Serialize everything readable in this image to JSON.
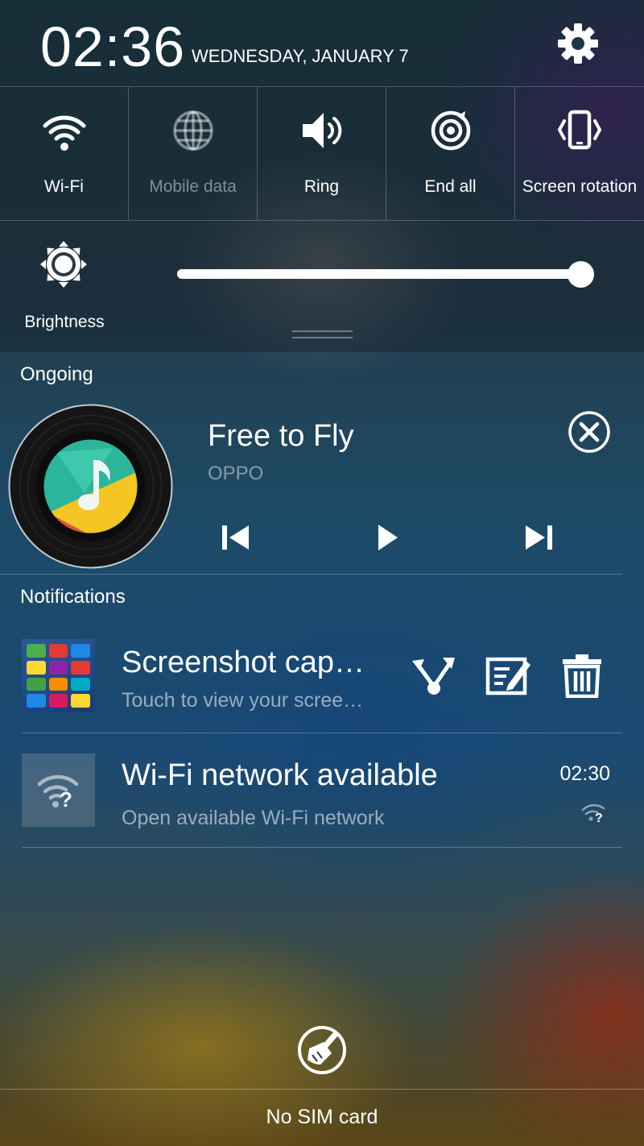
{
  "status": {
    "time": "02:36",
    "date": "WEDNESDAY, JANUARY 7",
    "settings_icon": "gear-icon"
  },
  "quick_toggles": [
    {
      "label": "Wi-Fi",
      "icon": "wifi-icon",
      "active": true
    },
    {
      "label": "Mobile data",
      "icon": "globe-icon",
      "active": false
    },
    {
      "label": "Ring",
      "icon": "speaker-icon",
      "active": true
    },
    {
      "label": "End all",
      "icon": "end-all-icon",
      "active": true
    },
    {
      "label": "Screen rotation",
      "icon": "screen-rotation-icon",
      "active": true
    }
  ],
  "brightness": {
    "label": "Brightness",
    "level": 1.0
  },
  "ongoing": {
    "section_title": "Ongoing",
    "song_title": "Free to Fly",
    "artist": "OPPO",
    "accent_colors": [
      "#2bb59b",
      "#f3c623",
      "#e0523e"
    ]
  },
  "notifications": {
    "section_title": "Notifications",
    "items": [
      {
        "title": "Screenshot cap…",
        "subtitle": "Touch to view your scree…",
        "actions": [
          "share-icon",
          "edit-icon",
          "delete-icon"
        ]
      },
      {
        "title": "Wi-Fi network available",
        "subtitle": "Open available Wi-Fi network",
        "time": "02:30",
        "icon": "wifi-question-icon"
      }
    ]
  },
  "footer": {
    "clear_icon": "broom-icon",
    "sim_status": "No SIM card"
  }
}
